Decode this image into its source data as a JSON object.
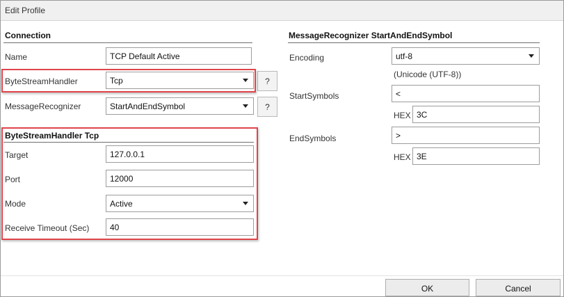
{
  "window": {
    "title": "Edit Profile"
  },
  "connection": {
    "heading": "Connection",
    "name_label": "Name",
    "name_value": "TCP Default Active",
    "bsh_label": "ByteStreamHandler",
    "bsh_value": "Tcp",
    "mr_label": "MessageRecognizer",
    "mr_value": "StartAndEndSymbol",
    "help_label": "?"
  },
  "bsh_tcp": {
    "heading": "ByteStreamHandler Tcp",
    "target_label": "Target",
    "target_value": "127.0.0.1",
    "port_label": "Port",
    "port_value": "12000",
    "mode_label": "Mode",
    "mode_value": "Active",
    "timeout_label": "Receive Timeout (Sec)",
    "timeout_value": "40"
  },
  "mr_section": {
    "heading": "MessageRecognizer StartAndEndSymbol",
    "encoding_label": "Encoding",
    "encoding_value": "utf-8",
    "encoding_desc": "(Unicode (UTF-8))",
    "start_label": "StartSymbols",
    "start_value": "<",
    "start_hex_label": "HEX",
    "start_hex_value": "3C",
    "end_label": "EndSymbols",
    "end_value": ">",
    "end_hex_label": "HEX",
    "end_hex_value": "3E"
  },
  "footer": {
    "ok_label": "OK",
    "cancel_label": "Cancel"
  },
  "colors": {
    "highlight_border": "#e0444b",
    "title_bar": "#f0f0f0",
    "button_bg": "#ececec"
  }
}
